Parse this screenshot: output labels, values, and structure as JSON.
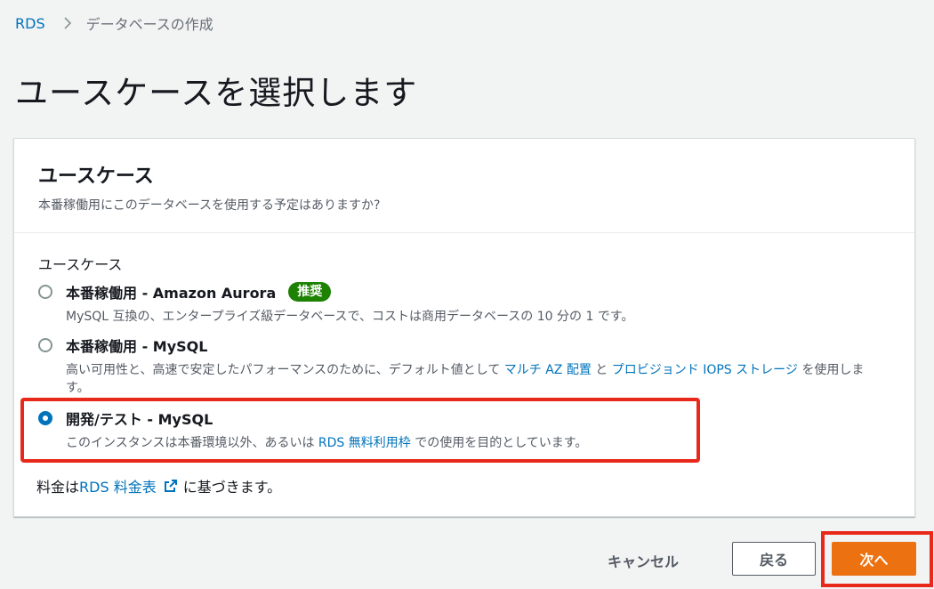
{
  "breadcrumb": {
    "root": "RDS",
    "current": "データベースの作成"
  },
  "page_title": "ユースケースを選択します",
  "panel": {
    "title": "ユースケース",
    "description": "本番稼働用にこのデータベースを使用する予定はありますか?",
    "field_label": "ユースケース",
    "options": [
      {
        "title": "本番稼働用 - Amazon Aurora",
        "badge": "推奨",
        "description": "MySQL 互換の、エンタープライズ級データベースで、コストは商用データベースの 10 分の 1 です。",
        "selected": false
      },
      {
        "title": "本番稼働用 - MySQL",
        "description_prefix": "高い可用性と、高速で安定したパフォーマンスのために、デフォルト値として ",
        "link1": "マルチ AZ 配置",
        "mid": " と ",
        "link2": "プロビジョンド IOPS ストレージ",
        "description_suffix": " を使用します。",
        "selected": false
      },
      {
        "title": "開発/テスト - MySQL",
        "description_prefix": "このインスタンスは本番環境以外、あるいは ",
        "link": "RDS 無料利用枠",
        "description_suffix": " での使用を目的としています。",
        "selected": true
      }
    ],
    "pricing_prefix": "料金は ",
    "pricing_link": "RDS 料金表",
    "pricing_suffix": "に基づきます。"
  },
  "footer": {
    "cancel": "キャンセル",
    "back": "戻る",
    "next": "次へ"
  },
  "icons": {
    "breadcrumb_separator": "chevron-right-icon",
    "external_link": "external-link-icon"
  },
  "colors": {
    "link": "#0073bb",
    "primary": "#ec7211",
    "badge": "#1d8102",
    "highlight": "#e8281a"
  }
}
